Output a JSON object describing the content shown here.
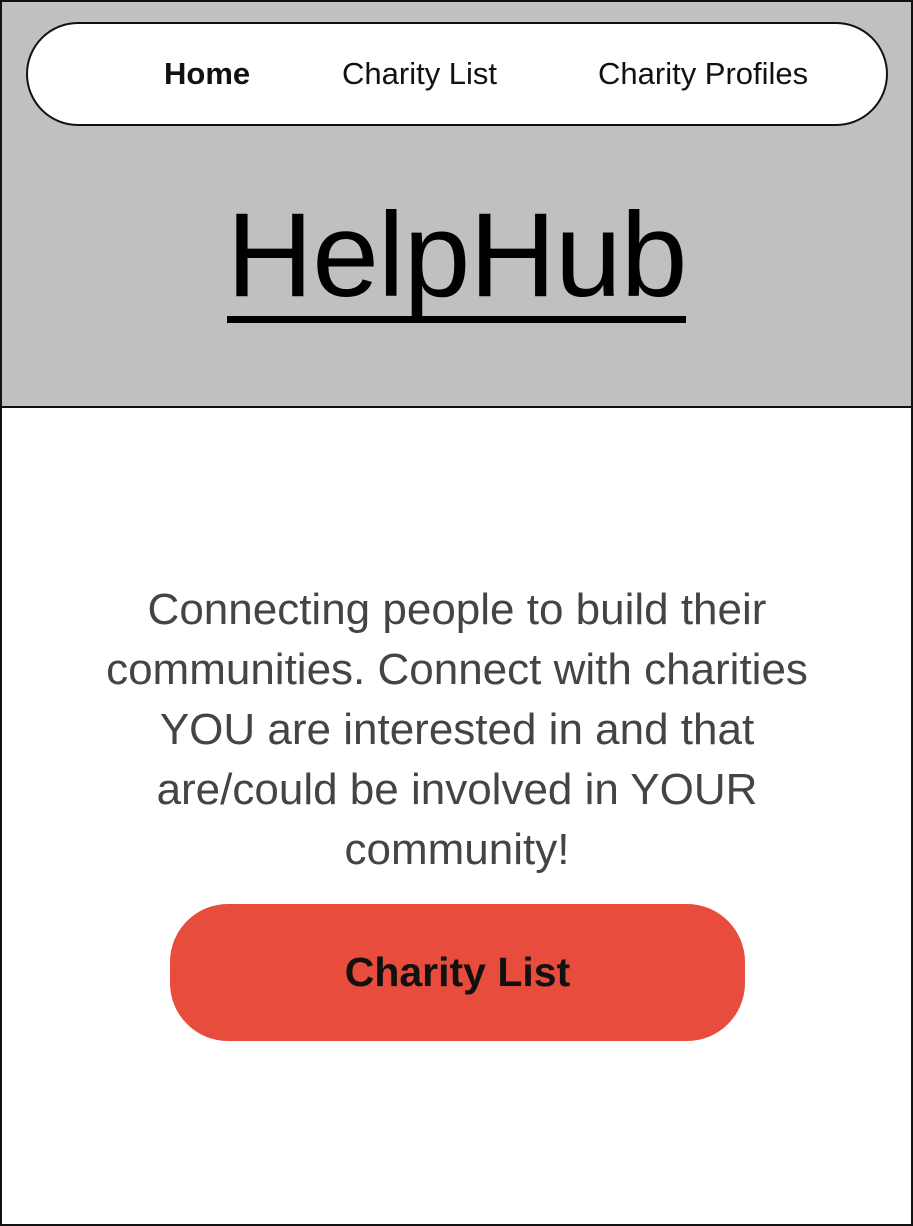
{
  "nav": {
    "items": [
      {
        "label": "Home",
        "active": true
      },
      {
        "label": "Charity List",
        "active": false
      },
      {
        "label": "Charity Profiles",
        "active": false
      }
    ]
  },
  "brand": {
    "title": "HelpHub"
  },
  "main": {
    "tagline": "Connecting people to build their communities. Connect with charities YOU are interested in and that are/could be involved in YOUR community!",
    "cta_label": "Charity List"
  },
  "colors": {
    "header_bg": "#c0c0c0",
    "cta_bg": "#e84c3d",
    "text": "#111111",
    "tagline_text": "#444444"
  }
}
